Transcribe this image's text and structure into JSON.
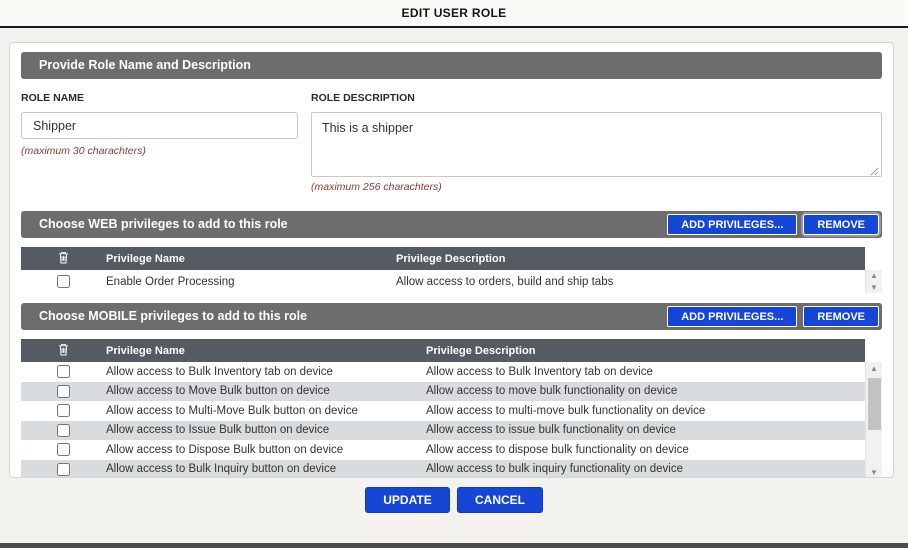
{
  "window": {
    "title": "EDIT USER ROLE"
  },
  "form": {
    "section_title": "Provide Role Name and Description",
    "role_name_label": "ROLE NAME",
    "role_name_value": "Shipper",
    "role_name_note": "(maximum 30 charachters)",
    "role_description_label": "ROLE DESCRIPTION",
    "role_description_value": "This is a shipper",
    "role_description_note": "(maximum 256 charachters)"
  },
  "web_privileges": {
    "section_title": "Choose WEB privileges to add to this role",
    "add_button_label": "ADD PRIVILEGES...",
    "remove_button_label": "REMOVE",
    "columns": {
      "name": "Privilege Name",
      "description": "Privilege Description"
    },
    "rows": [
      {
        "name": "Enable Order Processing",
        "description": "Allow access to orders, build and ship tabs",
        "checked": false
      }
    ]
  },
  "mobile_privileges": {
    "section_title": "Choose MOBILE privileges to add to this role",
    "add_button_label": "ADD PRIVILEGES...",
    "remove_button_label": "REMOVE",
    "columns": {
      "name": "Privilege Name",
      "description": "Privilege Description"
    },
    "rows": [
      {
        "name": "Allow access to Bulk Inventory tab on device",
        "description": "Allow access to Bulk Inventory tab on device",
        "checked": false
      },
      {
        "name": "Allow access to Move Bulk button on device",
        "description": "Allow access to move bulk functionality on device",
        "checked": false
      },
      {
        "name": "Allow access to Multi-Move Bulk button on device",
        "description": "Allow access to multi-move bulk functionality on device",
        "checked": false
      },
      {
        "name": "Allow access to Issue Bulk button on device",
        "description": "Allow access to issue bulk functionality on device",
        "checked": false
      },
      {
        "name": "Allow access to Dispose Bulk button on device",
        "description": "Allow access to dispose bulk functionality on device",
        "checked": false
      },
      {
        "name": "Allow access to Bulk Inquiry button on device",
        "description": "Allow access to bulk inquiry functionality on device",
        "checked": false
      }
    ]
  },
  "actions": {
    "update_label": "UPDATE",
    "cancel_label": "CANCEL"
  },
  "icons": {
    "delete_column": "trash-icon",
    "scroll_up": "up-arrow-icon",
    "scroll_down": "down-arrow-icon",
    "scroll_up_glyph": "▲",
    "scroll_down_glyph": "▼"
  },
  "colors": {
    "accent_blue": "#1546d6",
    "section_bar_gray": "#6d6d6d",
    "table_header_slate": "#565b63",
    "alt_row_gray": "#d9dcde",
    "note_red": "#8f3b38"
  }
}
